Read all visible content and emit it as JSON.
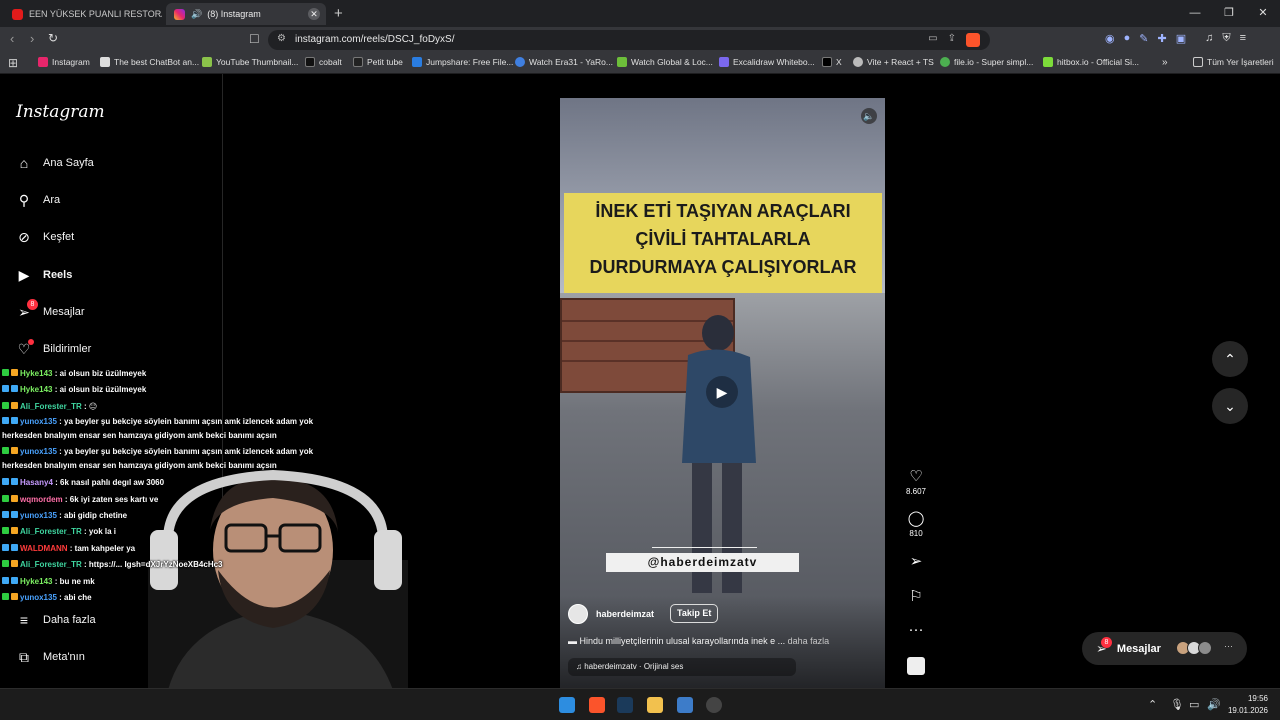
{
  "browser": {
    "tabs": [
      {
        "label": "EEN YÜKSEK PUANLI RESTORANLAR! ...",
        "active": false
      },
      {
        "label": "(8) Instagram",
        "active": true
      }
    ],
    "url": "instagram.com/reels/DSCJ_foDyxS/",
    "bookmarks": [
      "Instagram",
      "The best ChatBot an...",
      "YouTube Thumbnail...",
      "cobalt",
      "Petit tube",
      "Jumpshare: Free File...",
      "Watch Era31 - YaRo...",
      "Watch Global & Loc...",
      "Excalidraw Whitebo...",
      "X",
      "Vite + React + TS",
      "file.io - Super simpl...",
      "hitbox.io - Official Si...",
      "Tüm Yer İşaretleri"
    ]
  },
  "instagram": {
    "logo": "Instagram",
    "nav": [
      {
        "label": "Ana Sayfa",
        "icon": "home-icon"
      },
      {
        "label": "Ara",
        "icon": "search-icon"
      },
      {
        "label": "Keşfet",
        "icon": "compass-icon"
      },
      {
        "label": "Reels",
        "icon": "reels-icon"
      },
      {
        "label": "Mesajlar",
        "icon": "messenger-icon",
        "badge": "8"
      },
      {
        "label": "Bildirimler",
        "icon": "heart-icon"
      },
      {
        "label": "Daha fazla",
        "icon": "menu-icon"
      },
      {
        "label": "Meta'nın",
        "icon": "meta-icon"
      }
    ]
  },
  "chat": [
    {
      "user": "Hyke143",
      "color": "#7cf062",
      "text": "ai olsun biz üzülmeyek"
    },
    {
      "user": "Hyke143",
      "color": "#7cf062",
      "text": "ai olsun biz üzülmeyek"
    },
    {
      "user": "Ali_Forester_TR",
      "color": "#3fd6a0",
      "text": "😐"
    },
    {
      "user": "yunox135",
      "color": "#4aa3ff",
      "text": "ya beyler şu bekciye söylein banımı açsın amk izlencek adam yok herkesden bnalıyım ensar sen hamzaya gidiyom amk bekci banımı açsın"
    },
    {
      "user": "yunox135",
      "color": "#4aa3ff",
      "text": "ya beyler şu bekciye söylein banımı açsın amk izlencek adam yok herkesden bnalıyım ensar sen hamzaya gidiyom amk bekci banımı açsın"
    },
    {
      "user": "Hasany4",
      "color": "#c79bff",
      "text": "6k nasıl pahlı degıl aw 3060"
    },
    {
      "user": "wqmordem",
      "color": "#ff6fa8",
      "text": "6k iyi zaten ses kartı ve"
    },
    {
      "user": "yunox135",
      "color": "#4aa3ff",
      "text": "abi gidip chetine"
    },
    {
      "user": "Ali_Forester_TR",
      "color": "#3fd6a0",
      "text": "yok la i"
    },
    {
      "user": "WALDMANN",
      "color": "#ff3b3b",
      "text": "tam kahpeler ya"
    },
    {
      "user": "Ali_Forester_TR",
      "color": "#3fd6a0",
      "text": "https://... Igsh=dXJrYzNoeXB4cHc3"
    },
    {
      "user": "Hyke143",
      "color": "#7cf062",
      "text": "bu ne mk"
    },
    {
      "user": "yunox135",
      "color": "#4aa3ff",
      "text": "abi che"
    }
  ],
  "reel": {
    "banner_lines": [
      "İNEK ETİ TAŞIYAN ARAÇLARI",
      "ÇİVİLİ TAHTALARLA",
      "DURDURMAYA ÇALIŞIYORLAR"
    ],
    "watermark": "@haberdeimzatv",
    "author": "haberdeimzat",
    "follow_label": "Takip Et",
    "caption": "Hindu milliyetçilerinin ulusal karayollarında inek e ...",
    "caption_more": "daha fazla",
    "audio": "haberdeimzatv · Orijinal ses"
  },
  "actions": {
    "likes": "8.607",
    "comments": "810"
  },
  "messages_pill": {
    "label": "Mesajlar",
    "badge": "8"
  },
  "taskbar": {
    "time": "19:56",
    "date": "19.01.2026"
  },
  "colors": {
    "accent": "#ff3040",
    "banner": "#e7d65c",
    "background": "#000000"
  }
}
